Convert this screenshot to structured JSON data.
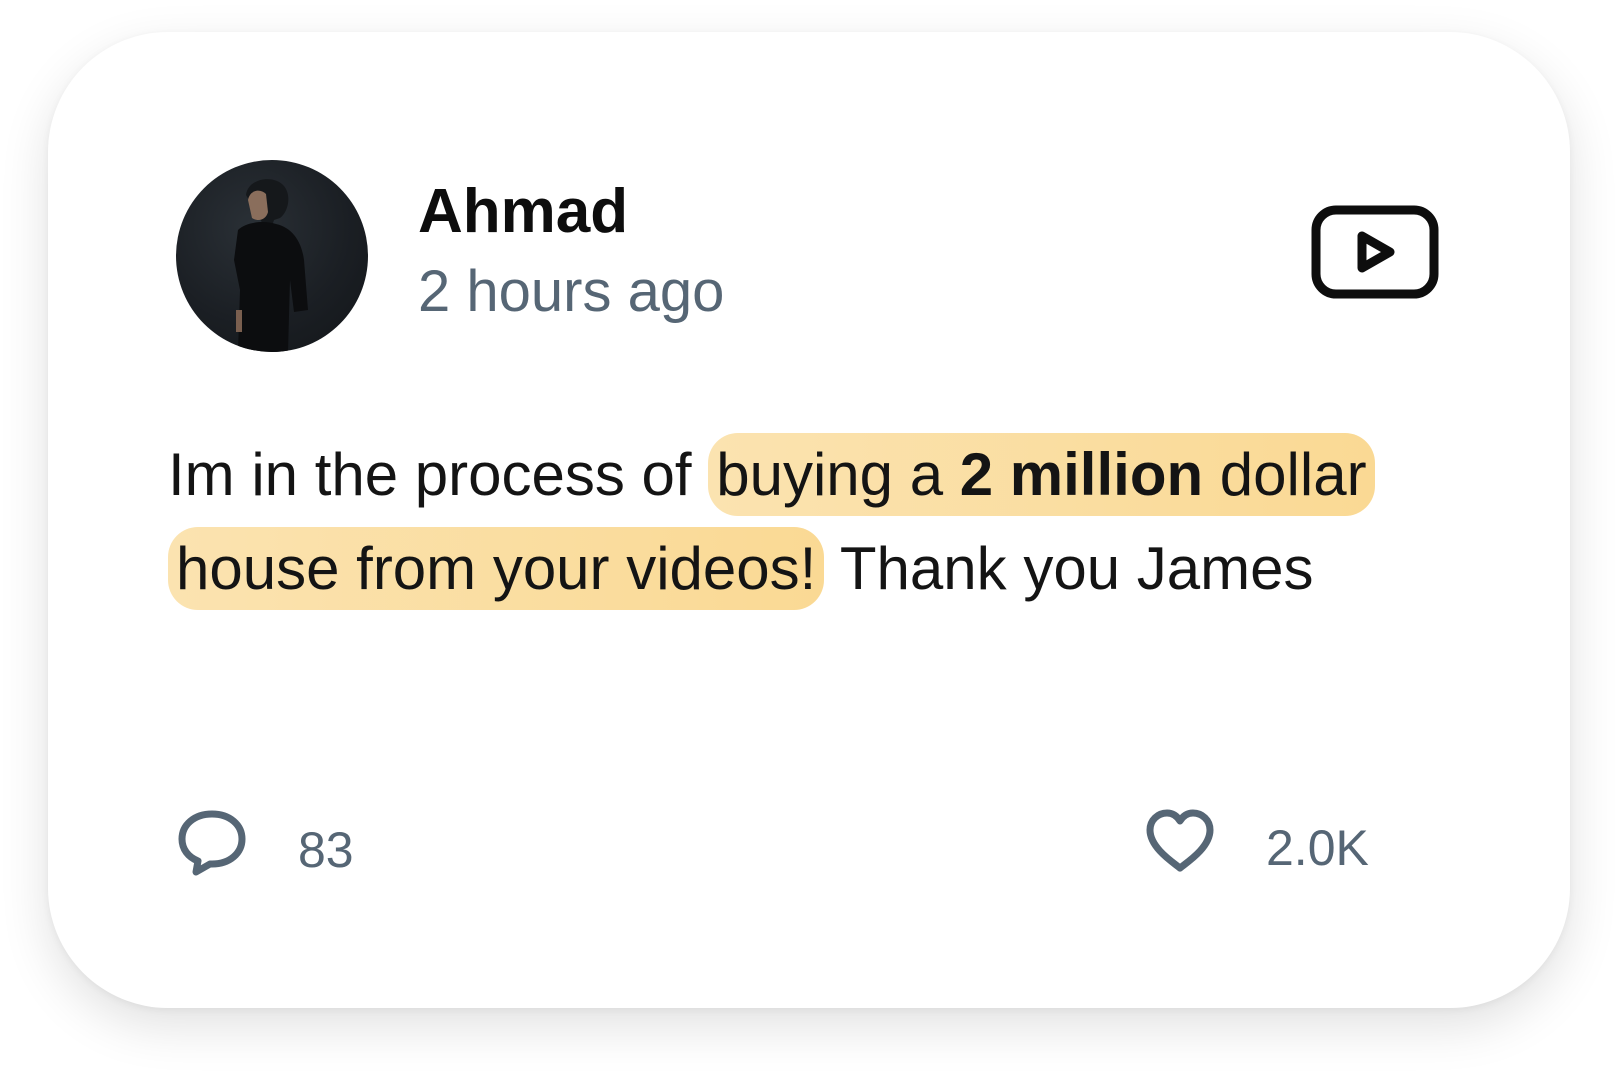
{
  "post": {
    "author": "Ahmad",
    "timestamp": "2 hours ago",
    "platform_icon": "youtube-play-icon",
    "body": {
      "lead": "Im in the process of ",
      "highlight_start": "buying a ",
      "highlight_bold": "2 million",
      "highlight_end": " dollar house from your videos!",
      "tail": " Thank you James"
    },
    "colors": {
      "highlight": "#fad994",
      "muted_text": "#566675",
      "body_text": "#141414"
    }
  },
  "stats": {
    "comments_icon": "comment-bubble-icon",
    "comments_count": "83",
    "likes_icon": "heart-icon",
    "likes_count": "2.0K"
  }
}
